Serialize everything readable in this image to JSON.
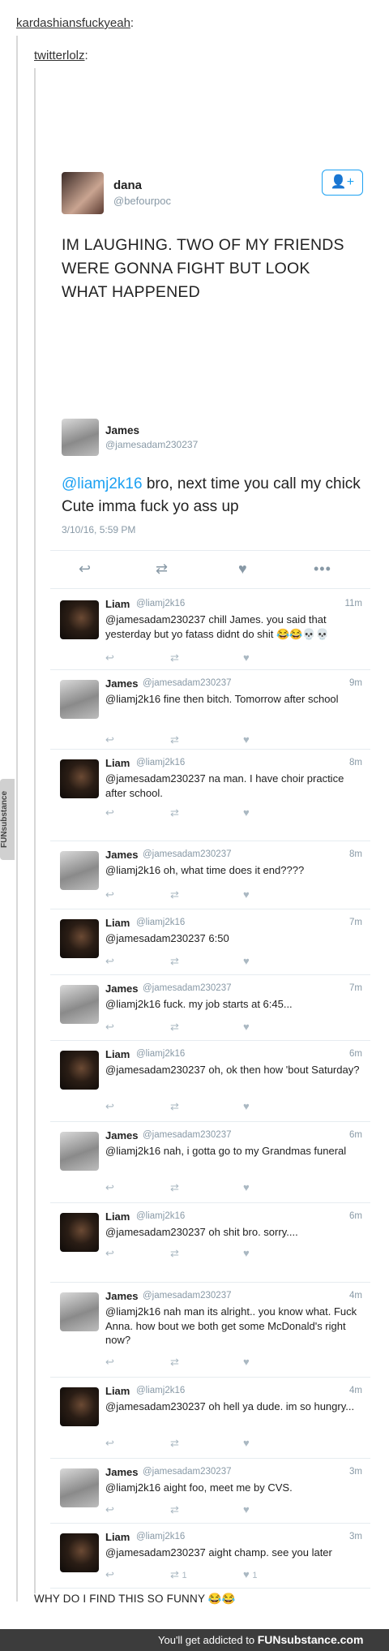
{
  "reblogs": [
    "kardashiansfuckyeah",
    "twitterlolz"
  ],
  "main_tweet": {
    "name": "dana",
    "handle": "@befourpoc",
    "follow_icon": "👤+",
    "text": "IM LAUGHING. TWO OF MY FRIENDS WERE GONNA FIGHT BUT LOOK WHAT HAPPENED"
  },
  "quoted_tweet": {
    "name": "James",
    "handle": "@jamesadam230237",
    "mention": "@liamj2k16",
    "text": " bro, next time you call my chick Cute imma fuck yo ass up",
    "date": "3/10/16, 5:59 PM"
  },
  "replies": [
    {
      "who": "liam",
      "name": "Liam",
      "handle": "@liamj2k16",
      "time": "11m",
      "text": "@jamesadam230237 chill James. you said that yesterday but yo fatass didnt do shit 😂😂💀💀"
    },
    {
      "who": "james",
      "name": "James",
      "handle": "@jamesadam230237",
      "time": "9m",
      "text": "@liamj2k16 fine then bitch. Tomorrow after school"
    },
    {
      "who": "liam",
      "name": "Liam",
      "handle": "@liamj2k16",
      "time": "8m",
      "text": "@jamesadam230237 na man. I have choir practice after school."
    },
    {
      "who": "james",
      "name": "James",
      "handle": "@jamesadam230237",
      "time": "8m",
      "text": "@liamj2k16 oh, what time does it end????"
    },
    {
      "who": "liam",
      "name": "Liam",
      "handle": "@liamj2k16",
      "time": "7m",
      "text": "@jamesadam230237 6:50"
    },
    {
      "who": "james",
      "name": "James",
      "handle": "@jamesadam230237",
      "time": "7m",
      "text": "@liamj2k16 fuck. my job starts at 6:45..."
    },
    {
      "who": "liam",
      "name": "Liam",
      "handle": "@liamj2k16",
      "time": "6m",
      "text": "@jamesadam230237 oh, ok then how 'bout Saturday?"
    },
    {
      "who": "james",
      "name": "James",
      "handle": "@jamesadam230237",
      "time": "6m",
      "text": "@liamj2k16 nah, i gotta go to my Grandmas funeral"
    },
    {
      "who": "liam",
      "name": "Liam",
      "handle": "@liamj2k16",
      "time": "6m",
      "text": "@jamesadam230237 oh shit bro. sorry...."
    },
    {
      "who": "james",
      "name": "James",
      "handle": "@jamesadam230237",
      "time": "4m",
      "text": "@liamj2k16 nah man its alright.. you know what. Fuck Anna. how bout we both get some McDonald's right now?"
    },
    {
      "who": "liam",
      "name": "Liam",
      "handle": "@liamj2k16",
      "time": "4m",
      "text": "@jamesadam230237 oh hell ya dude. im so hungry..."
    },
    {
      "who": "james",
      "name": "James",
      "handle": "@jamesadam230237",
      "time": "3m",
      "text": "@liamj2k16 aight foo, meet me by CVS."
    },
    {
      "who": "liam",
      "name": "Liam",
      "handle": "@liamj2k16",
      "time": "3m",
      "text": "@jamesadam230237 aight champ. see you later",
      "rt_count": "1",
      "like_count": "1"
    }
  ],
  "icons": {
    "reply": "reply-icon",
    "retweet": "retweet-icon",
    "like": "heart-icon",
    "more": "more-icon"
  },
  "caption": "WHY DO I FIND THIS SO FUNNY 😂😂",
  "watermark": "FUNsubstance",
  "footer": {
    "text": "You'll get addicted to ",
    "brand": "FUNsubstance.com"
  },
  "colors": {
    "link": "#1da1f2",
    "muted": "#8899a6"
  }
}
